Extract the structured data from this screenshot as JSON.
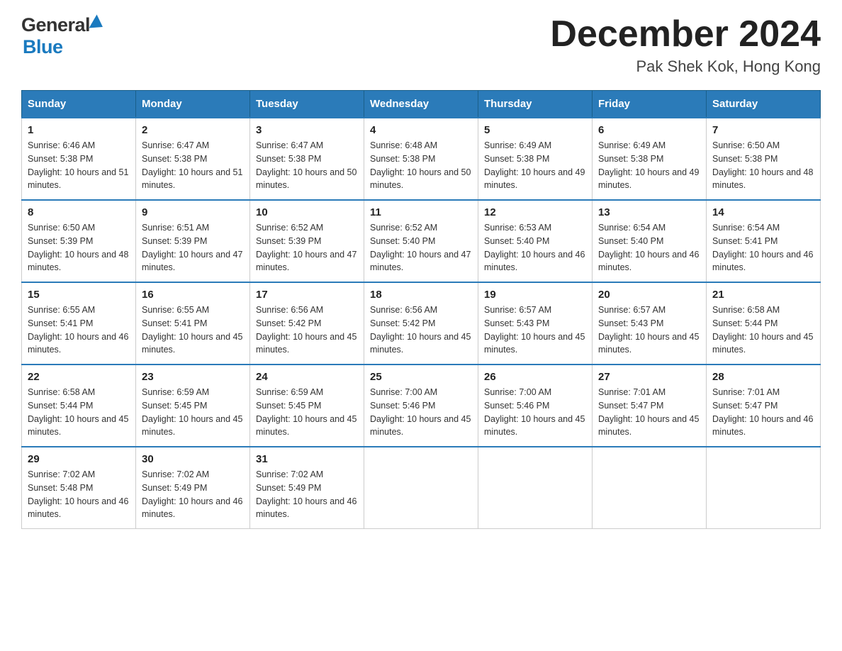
{
  "header": {
    "logo_general": "General",
    "logo_blue": "Blue",
    "month_title": "December 2024",
    "location": "Pak Shek Kok, Hong Kong"
  },
  "days_of_week": [
    "Sunday",
    "Monday",
    "Tuesday",
    "Wednesday",
    "Thursday",
    "Friday",
    "Saturday"
  ],
  "weeks": [
    [
      {
        "day": "1",
        "sunrise": "6:46 AM",
        "sunset": "5:38 PM",
        "daylight": "10 hours and 51 minutes."
      },
      {
        "day": "2",
        "sunrise": "6:47 AM",
        "sunset": "5:38 PM",
        "daylight": "10 hours and 51 minutes."
      },
      {
        "day": "3",
        "sunrise": "6:47 AM",
        "sunset": "5:38 PM",
        "daylight": "10 hours and 50 minutes."
      },
      {
        "day": "4",
        "sunrise": "6:48 AM",
        "sunset": "5:38 PM",
        "daylight": "10 hours and 50 minutes."
      },
      {
        "day": "5",
        "sunrise": "6:49 AM",
        "sunset": "5:38 PM",
        "daylight": "10 hours and 49 minutes."
      },
      {
        "day": "6",
        "sunrise": "6:49 AM",
        "sunset": "5:38 PM",
        "daylight": "10 hours and 49 minutes."
      },
      {
        "day": "7",
        "sunrise": "6:50 AM",
        "sunset": "5:38 PM",
        "daylight": "10 hours and 48 minutes."
      }
    ],
    [
      {
        "day": "8",
        "sunrise": "6:50 AM",
        "sunset": "5:39 PM",
        "daylight": "10 hours and 48 minutes."
      },
      {
        "day": "9",
        "sunrise": "6:51 AM",
        "sunset": "5:39 PM",
        "daylight": "10 hours and 47 minutes."
      },
      {
        "day": "10",
        "sunrise": "6:52 AM",
        "sunset": "5:39 PM",
        "daylight": "10 hours and 47 minutes."
      },
      {
        "day": "11",
        "sunrise": "6:52 AM",
        "sunset": "5:40 PM",
        "daylight": "10 hours and 47 minutes."
      },
      {
        "day": "12",
        "sunrise": "6:53 AM",
        "sunset": "5:40 PM",
        "daylight": "10 hours and 46 minutes."
      },
      {
        "day": "13",
        "sunrise": "6:54 AM",
        "sunset": "5:40 PM",
        "daylight": "10 hours and 46 minutes."
      },
      {
        "day": "14",
        "sunrise": "6:54 AM",
        "sunset": "5:41 PM",
        "daylight": "10 hours and 46 minutes."
      }
    ],
    [
      {
        "day": "15",
        "sunrise": "6:55 AM",
        "sunset": "5:41 PM",
        "daylight": "10 hours and 46 minutes."
      },
      {
        "day": "16",
        "sunrise": "6:55 AM",
        "sunset": "5:41 PM",
        "daylight": "10 hours and 45 minutes."
      },
      {
        "day": "17",
        "sunrise": "6:56 AM",
        "sunset": "5:42 PM",
        "daylight": "10 hours and 45 minutes."
      },
      {
        "day": "18",
        "sunrise": "6:56 AM",
        "sunset": "5:42 PM",
        "daylight": "10 hours and 45 minutes."
      },
      {
        "day": "19",
        "sunrise": "6:57 AM",
        "sunset": "5:43 PM",
        "daylight": "10 hours and 45 minutes."
      },
      {
        "day": "20",
        "sunrise": "6:57 AM",
        "sunset": "5:43 PM",
        "daylight": "10 hours and 45 minutes."
      },
      {
        "day": "21",
        "sunrise": "6:58 AM",
        "sunset": "5:44 PM",
        "daylight": "10 hours and 45 minutes."
      }
    ],
    [
      {
        "day": "22",
        "sunrise": "6:58 AM",
        "sunset": "5:44 PM",
        "daylight": "10 hours and 45 minutes."
      },
      {
        "day": "23",
        "sunrise": "6:59 AM",
        "sunset": "5:45 PM",
        "daylight": "10 hours and 45 minutes."
      },
      {
        "day": "24",
        "sunrise": "6:59 AM",
        "sunset": "5:45 PM",
        "daylight": "10 hours and 45 minutes."
      },
      {
        "day": "25",
        "sunrise": "7:00 AM",
        "sunset": "5:46 PM",
        "daylight": "10 hours and 45 minutes."
      },
      {
        "day": "26",
        "sunrise": "7:00 AM",
        "sunset": "5:46 PM",
        "daylight": "10 hours and 45 minutes."
      },
      {
        "day": "27",
        "sunrise": "7:01 AM",
        "sunset": "5:47 PM",
        "daylight": "10 hours and 45 minutes."
      },
      {
        "day": "28",
        "sunrise": "7:01 AM",
        "sunset": "5:47 PM",
        "daylight": "10 hours and 46 minutes."
      }
    ],
    [
      {
        "day": "29",
        "sunrise": "7:02 AM",
        "sunset": "5:48 PM",
        "daylight": "10 hours and 46 minutes."
      },
      {
        "day": "30",
        "sunrise": "7:02 AM",
        "sunset": "5:49 PM",
        "daylight": "10 hours and 46 minutes."
      },
      {
        "day": "31",
        "sunrise": "7:02 AM",
        "sunset": "5:49 PM",
        "daylight": "10 hours and 46 minutes."
      },
      null,
      null,
      null,
      null
    ]
  ]
}
